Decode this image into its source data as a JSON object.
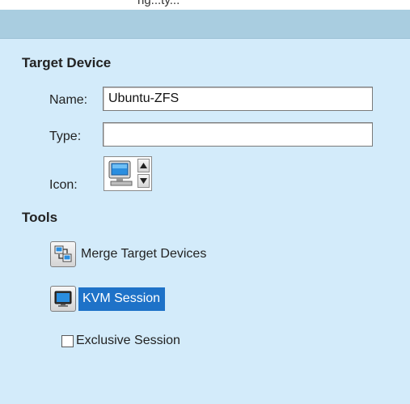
{
  "top_strip": {
    "text": "ng...ty..."
  },
  "target_device": {
    "heading": "Target Device",
    "name_label": "Name:",
    "name_value": "Ubuntu-ZFS",
    "type_label": "Type:",
    "type_value": "",
    "icon_label": "Icon:",
    "icon_value": "monitor-icon"
  },
  "tools": {
    "heading": "Tools",
    "merge_label": "Merge Target Devices",
    "kvm_label": "KVM Session",
    "exclusive_label": "Exclusive Session",
    "exclusive_checked": false
  },
  "colors": {
    "panel_background": "#d3ebfa",
    "header_bar": "#a9cde0",
    "selection": "#1e72c8"
  }
}
